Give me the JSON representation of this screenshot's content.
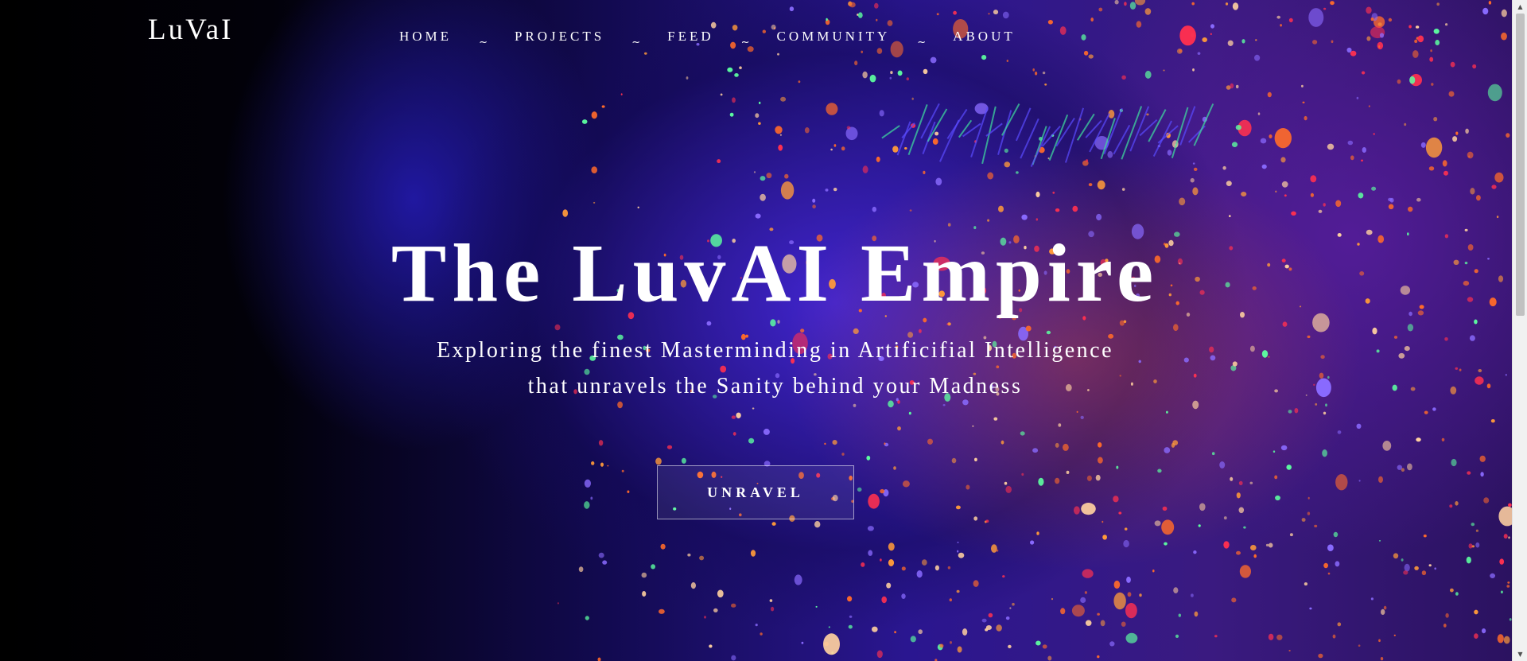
{
  "header": {
    "logo": "LuVaI",
    "nav": [
      {
        "label": "HOME"
      },
      {
        "label": "PROJECTS"
      },
      {
        "label": "FEED"
      },
      {
        "label": "COMMUNITY"
      },
      {
        "label": "ABOUT"
      }
    ],
    "separator": "~"
  },
  "hero": {
    "title": "The LuvAI Empire",
    "subtitle_line1": "Exploring the finest Masterminding in Artificifial Intelligence",
    "subtitle_line2": "that unravels the Sanity behind your Madness",
    "cta_label": "UNRAVEL",
    "background_image": "face-with-neon-glitter-paint"
  },
  "colors": {
    "text": "#ffffff",
    "background": "#000000",
    "glow_blue": "#3a1ee0",
    "speck_orange": "#ff6a2a",
    "speck_green": "#5dffa0",
    "speck_red": "#ff3050"
  },
  "scrollbar": {
    "up_icon": "scroll-up-arrow-icon",
    "down_icon": "scroll-down-arrow-icon"
  }
}
